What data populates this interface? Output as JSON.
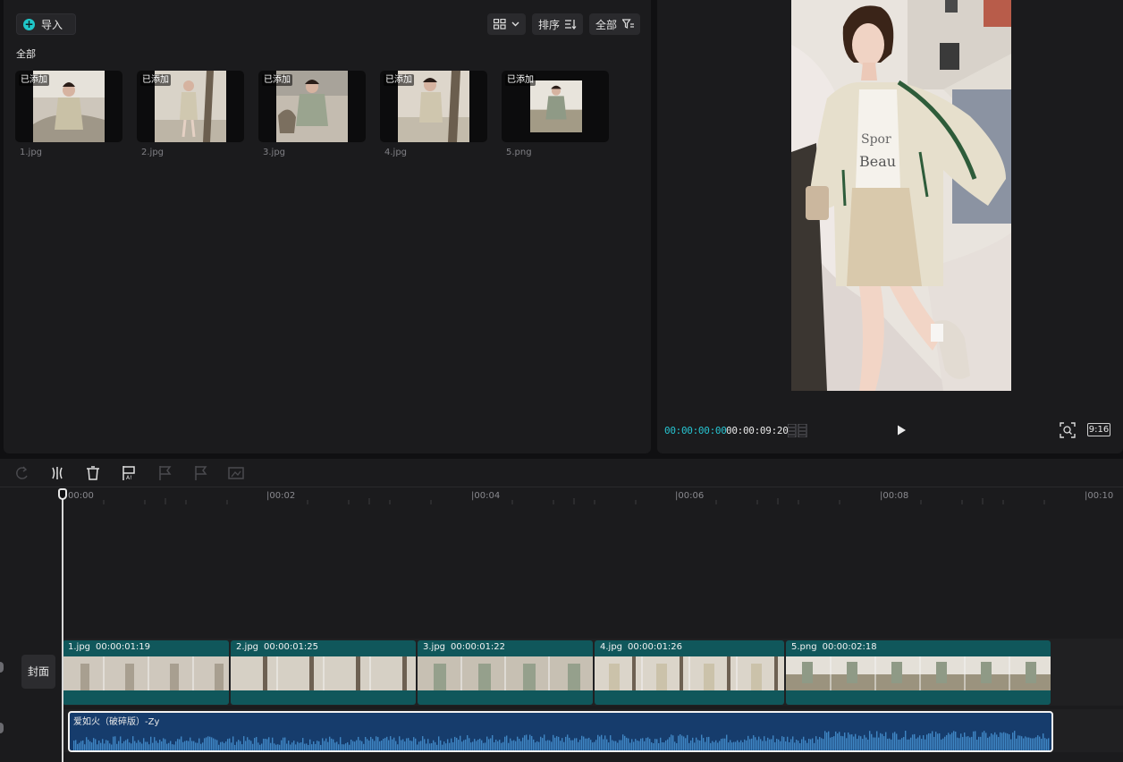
{
  "media": {
    "import_label": "导入",
    "sort_label": "排序",
    "filter_label": "全部",
    "section_label": "全部",
    "items": [
      {
        "badge": "已添加",
        "name": "1.jpg"
      },
      {
        "badge": "已添加",
        "name": "2.jpg"
      },
      {
        "badge": "已添加",
        "name": "3.jpg"
      },
      {
        "badge": "已添加",
        "name": "4.jpg"
      },
      {
        "badge": "已添加",
        "name": "5.png"
      }
    ]
  },
  "preview": {
    "current_time": "00:00:00:00",
    "total_duration": "00:00:09:20",
    "ratio": "9:16"
  },
  "timeline": {
    "ruler": [
      "00:00",
      "|00:02",
      "|00:04",
      "|00:06",
      "|00:08",
      "|00:10"
    ],
    "cover_label": "封面",
    "clips": [
      {
        "name": "1.jpg",
        "duration": "00:00:01:19"
      },
      {
        "name": "2.jpg",
        "duration": "00:00:01:25"
      },
      {
        "name": "3.jpg",
        "duration": "00:00:01:22"
      },
      {
        "name": "4.jpg",
        "duration": "00:00:01:26"
      },
      {
        "name": "5.png",
        "duration": "00:00:02:18"
      }
    ],
    "audio_name": "爱如火（破碎版）-Zy"
  },
  "colors": {
    "accent": "#27c3d0",
    "video_clip": "#10575b",
    "audio_clip": "#163c6c"
  },
  "icons": [
    "plus-icon",
    "grid-view-icon",
    "chevron-down-icon",
    "sort-icon",
    "filter-icon",
    "waveform-icon",
    "play-icon",
    "fullscreen-fit-icon",
    "undo-icon",
    "split-icon",
    "delete-icon",
    "freeze-frame-icon",
    "flag-icon",
    "mask-icon"
  ]
}
